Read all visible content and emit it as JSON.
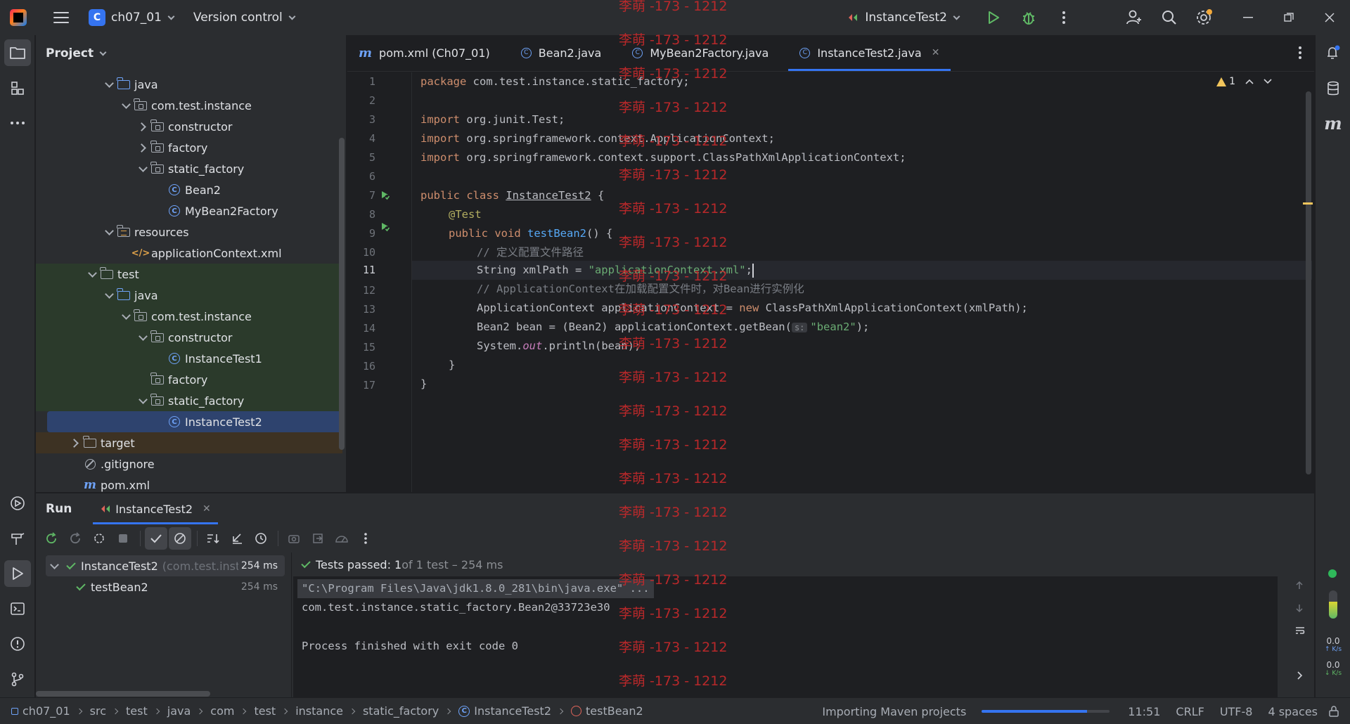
{
  "titlebar": {
    "project_badge": "C",
    "project_name": "ch07_01",
    "vcs_label": "Version control",
    "run_config": "InstanceTest2"
  },
  "project_panel": {
    "title": "Project",
    "tree": [
      {
        "label": "java",
        "depth": 4,
        "expand": "down",
        "icon": "folder-blue",
        "style": ""
      },
      {
        "label": "com.test.instance",
        "depth": 5,
        "expand": "down",
        "icon": "package",
        "style": ""
      },
      {
        "label": "constructor",
        "depth": 6,
        "expand": "right",
        "icon": "package",
        "style": ""
      },
      {
        "label": "factory",
        "depth": 6,
        "expand": "right",
        "icon": "package",
        "style": ""
      },
      {
        "label": "static_factory",
        "depth": 6,
        "expand": "down",
        "icon": "package",
        "style": ""
      },
      {
        "label": "Bean2",
        "depth": 7,
        "expand": "none",
        "icon": "class",
        "style": ""
      },
      {
        "label": "MyBean2Factory",
        "depth": 7,
        "expand": "none",
        "icon": "class",
        "style": ""
      },
      {
        "label": "resources",
        "depth": 4,
        "expand": "down",
        "icon": "folder-res",
        "style": ""
      },
      {
        "label": "applicationContext.xml",
        "depth": 5,
        "expand": "none",
        "icon": "xml",
        "style": ""
      },
      {
        "label": "test",
        "depth": 3,
        "expand": "down",
        "icon": "folder",
        "style": "green"
      },
      {
        "label": "java",
        "depth": 4,
        "expand": "down",
        "icon": "folder-blue",
        "style": "green"
      },
      {
        "label": "com.test.instance",
        "depth": 5,
        "expand": "down",
        "icon": "package",
        "style": "green"
      },
      {
        "label": "constructor",
        "depth": 6,
        "expand": "down",
        "icon": "package",
        "style": "green"
      },
      {
        "label": "InstanceTest1",
        "depth": 7,
        "expand": "none",
        "icon": "class",
        "style": "green"
      },
      {
        "label": "factory",
        "depth": 6,
        "expand": "none",
        "icon": "package",
        "style": "green"
      },
      {
        "label": "static_factory",
        "depth": 6,
        "expand": "down",
        "icon": "package",
        "style": "green"
      },
      {
        "label": "InstanceTest2",
        "depth": 7,
        "expand": "none",
        "icon": "class",
        "style": "sel"
      },
      {
        "label": "target",
        "depth": 2,
        "expand": "right",
        "icon": "folder",
        "style": "target"
      },
      {
        "label": ".gitignore",
        "depth": 2,
        "expand": "none",
        "icon": "git",
        "style": ""
      },
      {
        "label": "pom.xml",
        "depth": 2,
        "expand": "none",
        "icon": "maven",
        "style": ""
      }
    ]
  },
  "editor": {
    "tabs": [
      {
        "label": "pom.xml (Ch07_01)",
        "icon": "maven",
        "active": false
      },
      {
        "label": "Bean2.java",
        "icon": "class",
        "active": false
      },
      {
        "label": "MyBean2Factory.java",
        "icon": "class",
        "active": false
      },
      {
        "label": "InstanceTest2.java",
        "icon": "class",
        "active": true
      }
    ],
    "warning_count": "1",
    "line_numbers": [
      "1",
      "2",
      "3",
      "4",
      "5",
      "6",
      "7",
      "8",
      "9",
      "10",
      "11",
      "12",
      "13",
      "14",
      "15",
      "16",
      "17"
    ],
    "current_line": "11",
    "code": {
      "l1_kw": "package",
      "l1_rest": " com.test.instance.static_factory;",
      "l3_kw": "import",
      "l3_rest": " org.junit.Test;",
      "l4_kw": "import",
      "l4_rest": " org.springframework.context.ApplicationContext;",
      "l5_kw": "import",
      "l5_rest": " org.springframework.context.support.ClassPathXmlApplicationContext;",
      "l7_kw": "public class",
      "l7_name": "InstanceTest2",
      "l7_rest": " {",
      "l8_ann": "@Test",
      "l9_kw": "public void",
      "l9_fn": "testBean2",
      "l9_rest": "() {",
      "l10_cm": "// 定义配置文件路径",
      "l11_a": "String xmlPath = ",
      "l11_str": "\"applicationContext.xml\"",
      "l11_b": ";",
      "l12_cm": "// ApplicationContext在加载配置文件时，对Bean进行实例化",
      "l13_a": "ApplicationContext applicationContext = ",
      "l13_kw": "new",
      "l13_b": " ClassPathXmlApplicationContext(xmlPath);",
      "l14_a": "Bean2 bean = (Bean2) applicationContext.getBean(",
      "l14_hint": "s:",
      "l14_str": "\"bean2\"",
      "l14_b": ");",
      "l15_a": "System.",
      "l15_it": "out",
      "l15_b": ".println(bean);",
      "l16": "}",
      "l17": "}"
    }
  },
  "run_panel": {
    "title": "Run",
    "tab_label": "InstanceTest2",
    "tests": [
      {
        "label": "InstanceTest2",
        "sub": "(com.test.inst",
        "time": "254 ms"
      },
      {
        "label": "testBean2",
        "sub": "",
        "time": "254 ms"
      }
    ],
    "status_passed": "Tests passed: 1",
    "status_rest": " of 1 test – 254 ms",
    "console": [
      "\"C:\\Program Files\\Java\\jdk1.8.0_281\\bin\\java.exe\" ...",
      "com.test.instance.static_factory.Bean2@33723e30",
      "Process finished with exit code 0"
    ]
  },
  "right_strip": {
    "up_rate": "0.0",
    "up_unit": "K/s",
    "down_rate": "0.0",
    "down_unit": "K/s"
  },
  "statusbar": {
    "breadcrumbs": [
      "ch07_01",
      "src",
      "test",
      "java",
      "com",
      "test",
      "instance",
      "static_factory",
      "InstanceTest2",
      "testBean2"
    ],
    "task": "Importing Maven projects",
    "progress": 0.82,
    "position": "11:51",
    "line_sep": "CRLF",
    "encoding": "UTF-8",
    "indent": "4 spaces"
  },
  "watermark": "李萌 -173 - 1212",
  "colors": {
    "accent": "#3574f0",
    "pass": "#5fb865",
    "watermark": "#c9292b"
  }
}
